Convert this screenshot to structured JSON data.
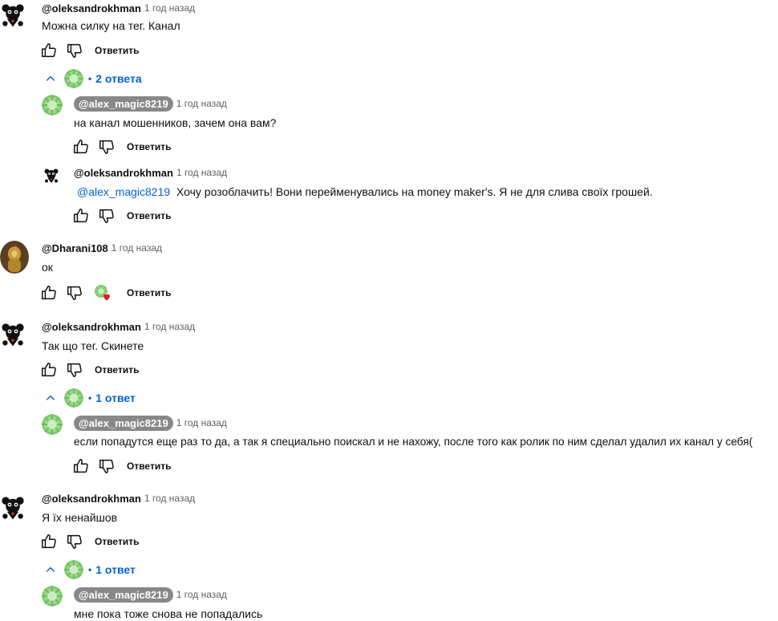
{
  "labels": {
    "reply": "Ответить"
  },
  "comments": [
    {
      "author": "@oleksandrokhman",
      "time": "1 год назад",
      "text": "Можна силку на тег. Канал"
    },
    {
      "toggle": "2 ответа"
    },
    {
      "author": "@alex_magic8219",
      "time": "1 год назад",
      "text": "на канал мошенников, зачем она вам?"
    },
    {
      "author": "@oleksandrokhman",
      "time": "1 год назад",
      "mention": "@alex_magic8219",
      "text": "Хочу розоблачить! Вони перейменувались на  money maker's. Я не для слива своїх грошей."
    },
    {
      "author": "@Dharani108",
      "time": "1 год назад",
      "text": "ок"
    },
    {
      "author": "@oleksandrokhman",
      "time": "1 год назад",
      "text": "Так що тег. Скинете"
    },
    {
      "toggle": "1 ответ"
    },
    {
      "author": "@alex_magic8219",
      "time": "1 год назад",
      "text": "если попадутся еще раз то да, а так я специально поискал и не нахожу, после того как ролик по ним сделал удалил их канал у себя("
    },
    {
      "author": "@oleksandrokhman",
      "time": "1 год назад",
      "text": "Я їх ненайшов"
    },
    {
      "toggle": "1 ответ"
    },
    {
      "author": "@alex_magic8219",
      "time": "1 год назад",
      "text": "мне пока тоже снова не попадались"
    }
  ],
  "colors": {
    "link": "#065fd4",
    "pill": "#888888",
    "heart": "#e5182d",
    "muted": "#606060"
  }
}
